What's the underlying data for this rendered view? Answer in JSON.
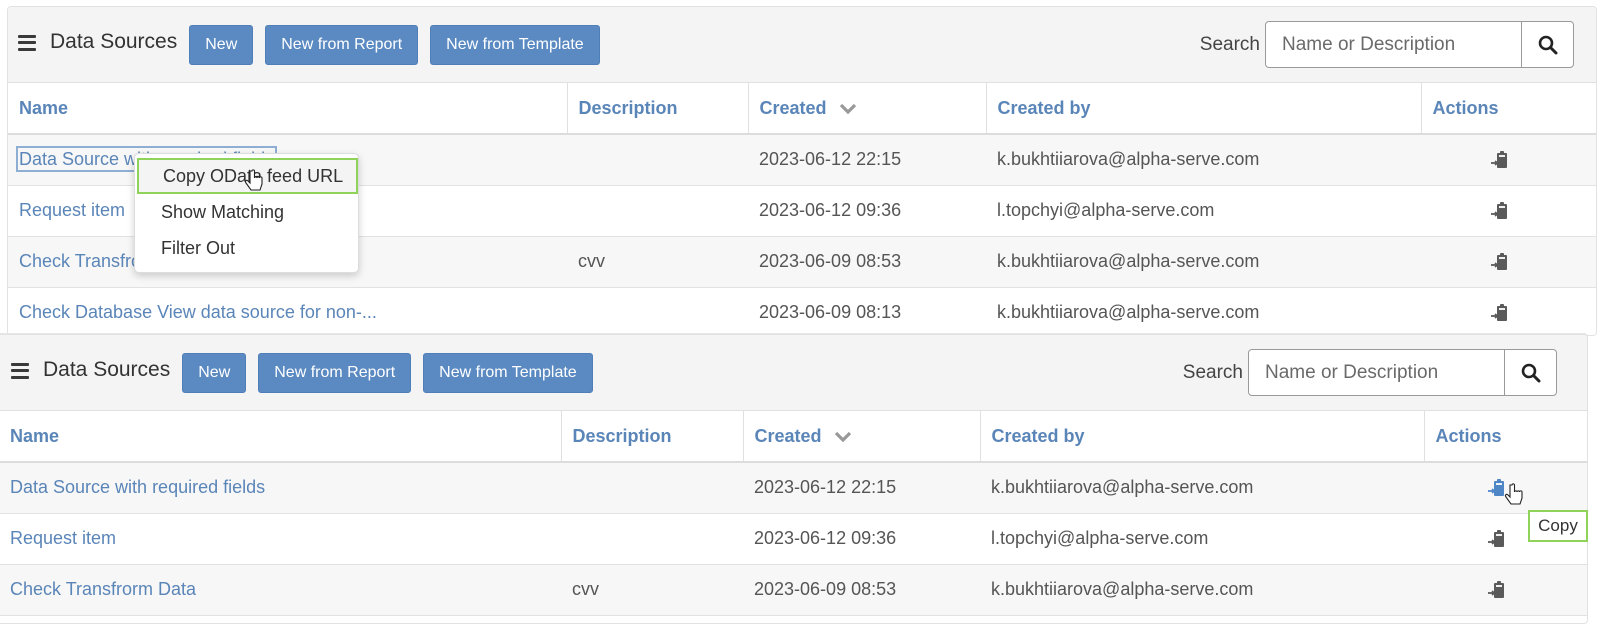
{
  "panels": [
    {
      "header": {
        "title": "Data Sources",
        "buttons": [
          "New",
          "New from Report",
          "New from Template"
        ],
        "search_label": "Search",
        "search_placeholder": "Name or Description"
      },
      "columns": [
        "Name",
        "Description",
        "Created",
        "Created by",
        "Actions"
      ],
      "rows": [
        {
          "name": "Data Source with required fields",
          "description": "",
          "created": "2023-06-12 22:15",
          "created_by": "k.bukhtiiarova@alpha-serve.com"
        },
        {
          "name": "Request item",
          "description": "",
          "created": "2023-06-12 09:36",
          "created_by": "l.topchyi@alpha-serve.com"
        },
        {
          "name": "Check Transfrorm Data",
          "description": "cvv",
          "created": "2023-06-09 08:53",
          "created_by": "k.bukhtiiarova@alpha-serve.com"
        },
        {
          "name": "Check Database View data source for non-...",
          "description": "",
          "created": "2023-06-09 08:13",
          "created_by": "k.bukhtiiarova@alpha-serve.com"
        }
      ]
    },
    {
      "header": {
        "title": "Data Sources",
        "buttons": [
          "New",
          "New from Report",
          "New from Template"
        ],
        "search_label": "Search",
        "search_placeholder": "Name or Description"
      },
      "columns": [
        "Name",
        "Description",
        "Created",
        "Created by",
        "Actions"
      ],
      "rows": [
        {
          "name": "Data Source with required fields",
          "description": "",
          "created": "2023-06-12 22:15",
          "created_by": "k.bukhtiiarova@alpha-serve.com"
        },
        {
          "name": "Request item",
          "description": "",
          "created": "2023-06-12 09:36",
          "created_by": "l.topchyi@alpha-serve.com"
        },
        {
          "name": "Check Transfrorm Data",
          "description": "cvv",
          "created": "2023-06-09 08:53",
          "created_by": "k.bukhtiiarova@alpha-serve.com"
        }
      ]
    }
  ],
  "context_menu": {
    "items": [
      "Copy OData feed URL",
      "Show Matching",
      "Filter Out"
    ],
    "highlighted_index": 0
  },
  "tooltip": "Copy",
  "icons": {
    "menu": "hamburger-menu-icon",
    "search": "search-icon",
    "sort": "chevron-down-icon",
    "action": "clipboard-paste-icon"
  },
  "colors": {
    "primary_button": "#5b8ac2",
    "header_text": "#5a85b8",
    "highlight_border": "#8fd35a"
  }
}
